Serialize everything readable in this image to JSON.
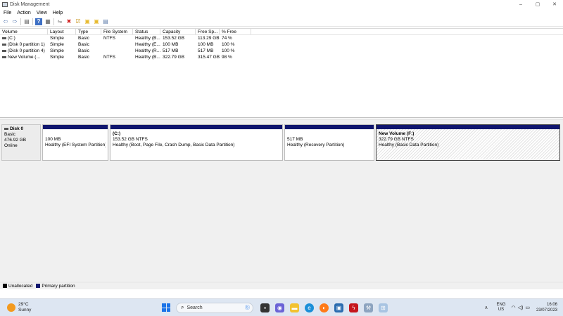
{
  "window": {
    "title": "Disk Management",
    "minimize": "–",
    "maximize": "▢",
    "close": "✕"
  },
  "menu": [
    "File",
    "Action",
    "View",
    "Help"
  ],
  "toolbar": [
    {
      "name": "back-icon",
      "glyph": "⇦"
    },
    {
      "name": "forward-icon",
      "glyph": "⇨"
    },
    {
      "name": "console-tree-icon",
      "glyph": "▤"
    },
    {
      "name": "help-icon",
      "glyph": "?"
    },
    {
      "name": "properties-icon",
      "glyph": "▦"
    },
    {
      "name": "connect-icon",
      "glyph": "⇋"
    },
    {
      "name": "delete-icon",
      "glyph": "✖"
    },
    {
      "name": "checklist-icon",
      "glyph": "☑"
    },
    {
      "name": "folder-icon",
      "glyph": "▣"
    },
    {
      "name": "folder-search-icon",
      "glyph": "▣"
    },
    {
      "name": "list-icon",
      "glyph": "▤"
    }
  ],
  "volume_table": {
    "headers": [
      "Volume",
      "Layout",
      "Type",
      "File System",
      "Status",
      "Capacity",
      "Free Sp...",
      "% Free"
    ],
    "rows": [
      [
        "(C:)",
        "Simple",
        "Basic",
        "NTFS",
        "Healthy (B...",
        "153.52 GB",
        "113.29 GB",
        "74 %"
      ],
      [
        "(Disk 0 partition 1)",
        "Simple",
        "Basic",
        "",
        "Healthy (E...",
        "100 MB",
        "100 MB",
        "100 %"
      ],
      [
        "(Disk 0 partition 4)",
        "Simple",
        "Basic",
        "",
        "Healthy (R...",
        "517 MB",
        "517 MB",
        "100 %"
      ],
      [
        "New Volume (...",
        "Simple",
        "Basic",
        "NTFS",
        "Healthy (B...",
        "322.79 GB",
        "315.47 GB",
        "98 %"
      ]
    ]
  },
  "disk": {
    "name": "Disk 0",
    "type": "Basic",
    "size": "476.92 GB",
    "status": "Online",
    "partitions": [
      {
        "name": "",
        "size": "100 MB",
        "status": "Healthy (EFI System Partition)"
      },
      {
        "name": "(C:)",
        "size": "153.52 GB NTFS",
        "status": "Healthy (Boot, Page File, Crash Dump, Basic Data Partition)"
      },
      {
        "name": "",
        "size": "517 MB",
        "status": "Healthy (Recovery Partition)"
      },
      {
        "name": "New Volume  (F:)",
        "size": "322.79 GB NTFS",
        "status": "Healthy (Basic Data Partition)"
      }
    ]
  },
  "legend": {
    "unallocated": {
      "label": "Unallocated",
      "color": "#000000"
    },
    "primary": {
      "label": "Primary partition",
      "color": "#10166e"
    }
  },
  "taskbar": {
    "temp": "29°C",
    "weather": "Sunny",
    "search_label": "Search",
    "lang_top": "ENG",
    "lang_bottom": "US",
    "time": "16:06",
    "date": "23/07/2023"
  }
}
